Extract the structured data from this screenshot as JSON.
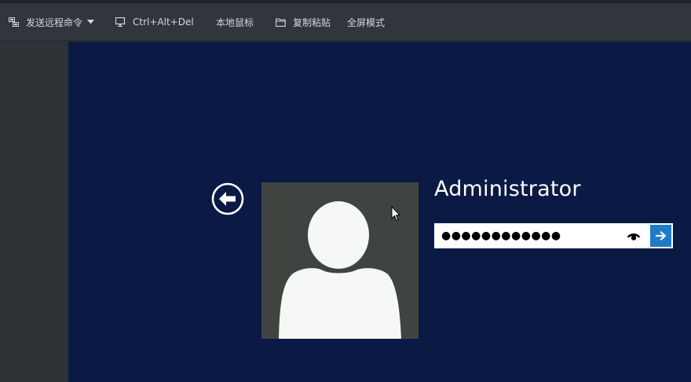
{
  "toolbar": {
    "send_remote_command": {
      "label": "发送远程命令",
      "icon": "remote-command-icon"
    },
    "ctrl_alt_del": {
      "label": "Ctrl+Alt+Del",
      "icon": "monitor-icon"
    },
    "local_mouse": {
      "label": "本地鼠标"
    },
    "copy_paste": {
      "label": "复制粘贴",
      "icon": "folder-icon"
    },
    "fullscreen": {
      "label": "全屏模式"
    }
  },
  "login": {
    "username": "Administrator",
    "password_mask": "●●●●●●●●●●●●",
    "reveal_icon": "eye-icon",
    "submit_icon": "arrow-right-icon",
    "back_icon": "back-arrow-icon",
    "avatar_icon": "user-avatar-icon"
  },
  "colors": {
    "screen_bg": "#0a1a45",
    "toolbar_bg": "#30363b",
    "avatar_bg": "#404441",
    "accent": "#1f7ac9"
  }
}
